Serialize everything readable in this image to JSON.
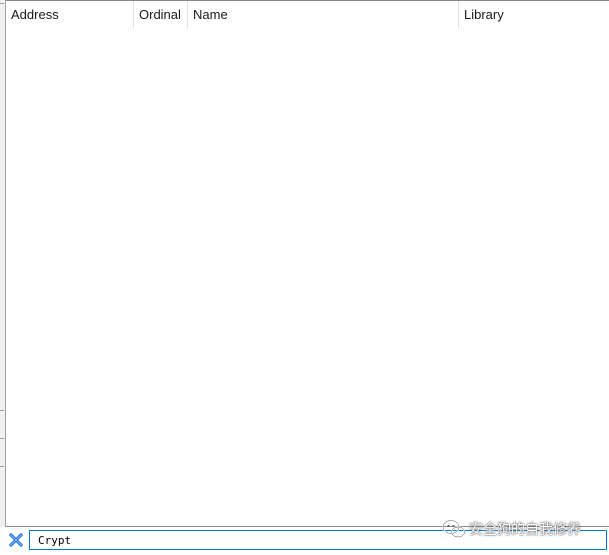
{
  "table": {
    "columns": [
      {
        "label": "Address"
      },
      {
        "label": "Ordinal"
      },
      {
        "label": "Name"
      },
      {
        "label": "Library"
      }
    ],
    "rows": []
  },
  "search": {
    "value": "Crypt",
    "clear_icon": "blue-x-icon"
  },
  "watermark": {
    "text": "安全狗的自我修养",
    "icon": "wechat-icon"
  },
  "colors": {
    "accent": "#0078d7",
    "clear_icon": "#1e6ed6"
  }
}
